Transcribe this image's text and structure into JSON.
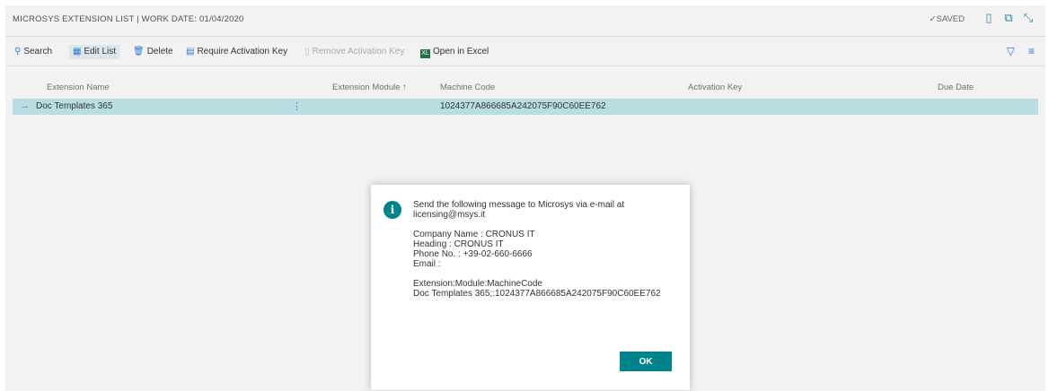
{
  "header": {
    "title": "MICROSYS EXTENSION LIST | WORK DATE: 01/04/2020",
    "saved": "✓SAVED",
    "icons": [
      "bookmark-icon",
      "open-new-window-icon",
      "collapse-icon"
    ]
  },
  "toolbar": {
    "search": "Search",
    "edit_list": "Edit List",
    "delete": "Delete",
    "require_key": "Require Activation Key",
    "remove_key": "Remove Activation Key",
    "open_excel": "Open in Excel",
    "excel_badge": "XL"
  },
  "table": {
    "columns": [
      "Extension Name",
      "Extension Module ↑",
      "Machine Code",
      "Activation Key",
      "Due Date"
    ],
    "rows": [
      {
        "extension_name": "Doc Templates 365",
        "extension_module": "",
        "machine_code": "1024377A866685A242075F90C60EE762",
        "activation_key": "",
        "due_date": ""
      }
    ]
  },
  "dialog": {
    "line1": "Send the following message to Microsys via e-mail at",
    "line2": "licensing@msys.it",
    "company": "Company Name : CRONUS IT",
    "heading": "Heading : CRONUS IT",
    "phone": "Phone No. : +39-02-660-6666",
    "email": "Email :",
    "ext_header": "Extension:Module:MachineCode",
    "ext_value": "Doc Templates 365;:1024377A866685A242075F90C60EE762",
    "ok": "OK"
  },
  "colors": {
    "accent": "#00848c",
    "selected_row": "#b9dee2",
    "link_blue": "#2b7ad6"
  }
}
